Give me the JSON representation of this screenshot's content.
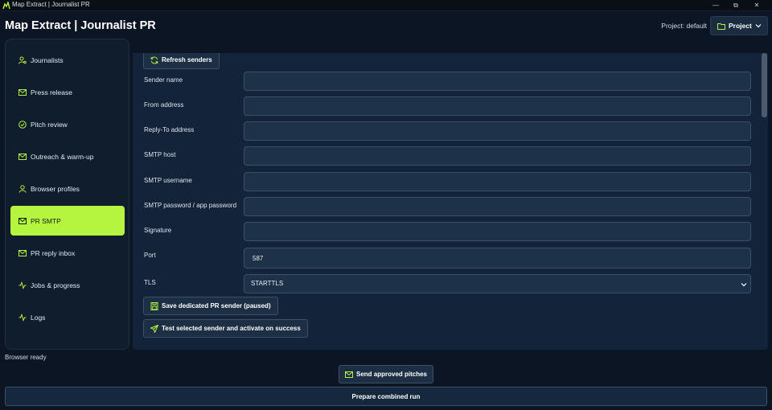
{
  "window": {
    "title": "Map Extract | Journalist PR",
    "minimize": "—",
    "restore": "⧉",
    "close": "✕"
  },
  "header": {
    "app_title": "Map Extract | Journalist PR",
    "project_label": "Project: default",
    "project_button": "Project"
  },
  "sidebar": {
    "items": [
      {
        "label": "Journalists",
        "icon": "user-search-icon"
      },
      {
        "label": "Press release",
        "icon": "mail-icon"
      },
      {
        "label": "Pitch review",
        "icon": "check-circle-icon"
      },
      {
        "label": "Outreach & warm-up",
        "icon": "mail-icon"
      },
      {
        "label": "Browser profiles",
        "icon": "user-icon"
      },
      {
        "label": "PR SMTP",
        "icon": "mail-icon",
        "active": true
      },
      {
        "label": "PR reply inbox",
        "icon": "mail-icon"
      },
      {
        "label": "Jobs & progress",
        "icon": "activity-icon"
      },
      {
        "label": "Logs",
        "icon": "activity-icon"
      }
    ]
  },
  "main": {
    "refresh_button": "Refresh senders",
    "fields": [
      {
        "label": "Sender name",
        "value": ""
      },
      {
        "label": "From address",
        "value": ""
      },
      {
        "label": "Reply-To address",
        "value": ""
      },
      {
        "label": "SMTP host",
        "value": ""
      },
      {
        "label": "SMTP username",
        "value": ""
      },
      {
        "label": "SMTP password / app password",
        "value": ""
      },
      {
        "label": "Signature",
        "value": ""
      },
      {
        "label": "Port",
        "value": "587"
      }
    ],
    "tls": {
      "label": "TLS",
      "value": "STARTTLS"
    },
    "save_button": "Save dedicated PR sender (paused)",
    "test_button": "Test selected sender and activate on success"
  },
  "footer": {
    "status": "Browser ready",
    "send_button": "Send approved pitches",
    "prepare_button": "Prepare combined run"
  },
  "colors": {
    "accent": "#b6f53f",
    "background": "#0b1523",
    "panel": "#13243a"
  }
}
